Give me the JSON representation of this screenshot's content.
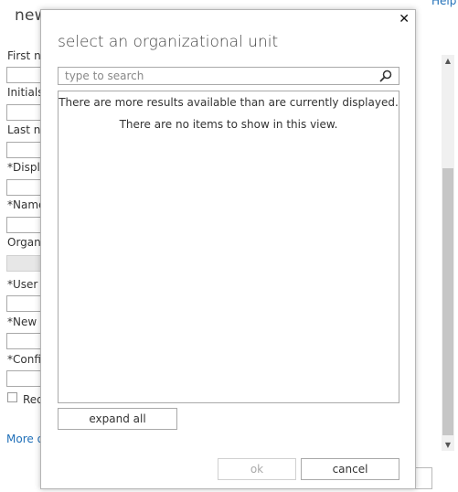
{
  "background": {
    "title": "new",
    "help_link": "Help",
    "fields": [
      {
        "label": "First na"
      },
      {
        "label": "Initials:"
      },
      {
        "label": "Last na"
      },
      {
        "label": "*Displa"
      },
      {
        "label": "*Name"
      },
      {
        "label": "Organi"
      },
      {
        "label": "*User lo"
      },
      {
        "label": "*New p"
      },
      {
        "label": "*Confir"
      }
    ],
    "checkbox_label": "Req",
    "more_link": "More o"
  },
  "dialog": {
    "title": "select an organizational unit",
    "search_placeholder": "type to search",
    "search_value": "",
    "messages": {
      "more_results": "There are more results available than are currently displayed.",
      "no_items": "There are no items to show in this view."
    },
    "expand_all_label": "expand all",
    "ok_label": "ok",
    "cancel_label": "cancel"
  },
  "icons": {
    "close": "close-icon",
    "search": "search-icon"
  }
}
